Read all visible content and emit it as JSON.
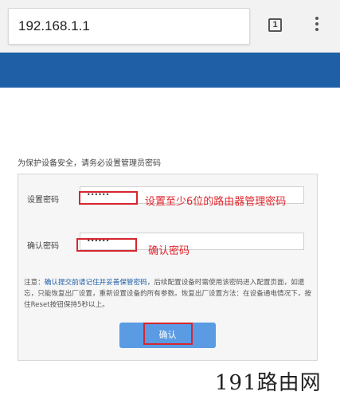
{
  "browser": {
    "url": "192.168.1.1",
    "tab_count": "1"
  },
  "page": {
    "prompt": "为保护设备安全，请务必设置管理员密码",
    "set_password_label": "设置密码",
    "set_password_value": "••••••",
    "confirm_password_label": "确认密码",
    "confirm_password_value": "••••••",
    "note_prefix": "注意：",
    "note_highlight": "确认提交前请记住并妥善保管密码",
    "note_rest": "，后续配置设备时需使用该密码进入配置页面，如遗忘，只能恢复出厂设置，重新设置设备的所有参数。恢复出厂设置方法：在设备通电情况下，按住Reset按钮保持5秒以上。",
    "confirm_button": "确认"
  },
  "annotations": {
    "set_password_hint": "设置至少6位的路由器管理密码",
    "confirm_password_hint": "确认密码"
  },
  "watermark": "191路由网",
  "colors": {
    "banner": "#1f5fa6",
    "highlight": "#d6262f",
    "button": "#5a9be3"
  }
}
